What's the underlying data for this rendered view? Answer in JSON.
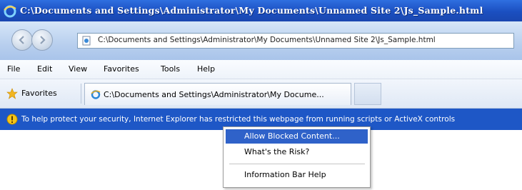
{
  "window": {
    "title": "C:\\Documents and Settings\\Administrator\\My Documents\\Unnamed Site 2\\Js_Sample.html"
  },
  "address_bar": {
    "url": "C:\\Documents and Settings\\Administrator\\My Documents\\Unnamed Site 2\\Js_Sample.html"
  },
  "menu": {
    "items": [
      "File",
      "Edit",
      "View",
      "Favorites",
      "Tools",
      "Help"
    ]
  },
  "favorites_bar": {
    "label": "Favorites",
    "tab_title": "C:\\Documents and Settings\\Administrator\\My Docume..."
  },
  "info_bar": {
    "text": "To help protect your security, Internet Explorer has restricted this webpage from running scripts or ActiveX controls"
  },
  "context_menu": {
    "items": [
      "Allow Blocked Content...",
      "What's the Risk?",
      "Information Bar Help"
    ],
    "selected": "Allow Blocked Content..."
  },
  "icons": {
    "ie_logo": "ie-logo-icon",
    "back": "back-arrow-icon",
    "forward": "forward-arrow-icon",
    "page": "page-icon",
    "favorites_star": "star-icon",
    "info_shield": "shield-icon"
  },
  "colors": {
    "titlebar": "#1b4fc0",
    "info_bar": "#1e57c6",
    "menu_highlight": "#2f62c9"
  }
}
